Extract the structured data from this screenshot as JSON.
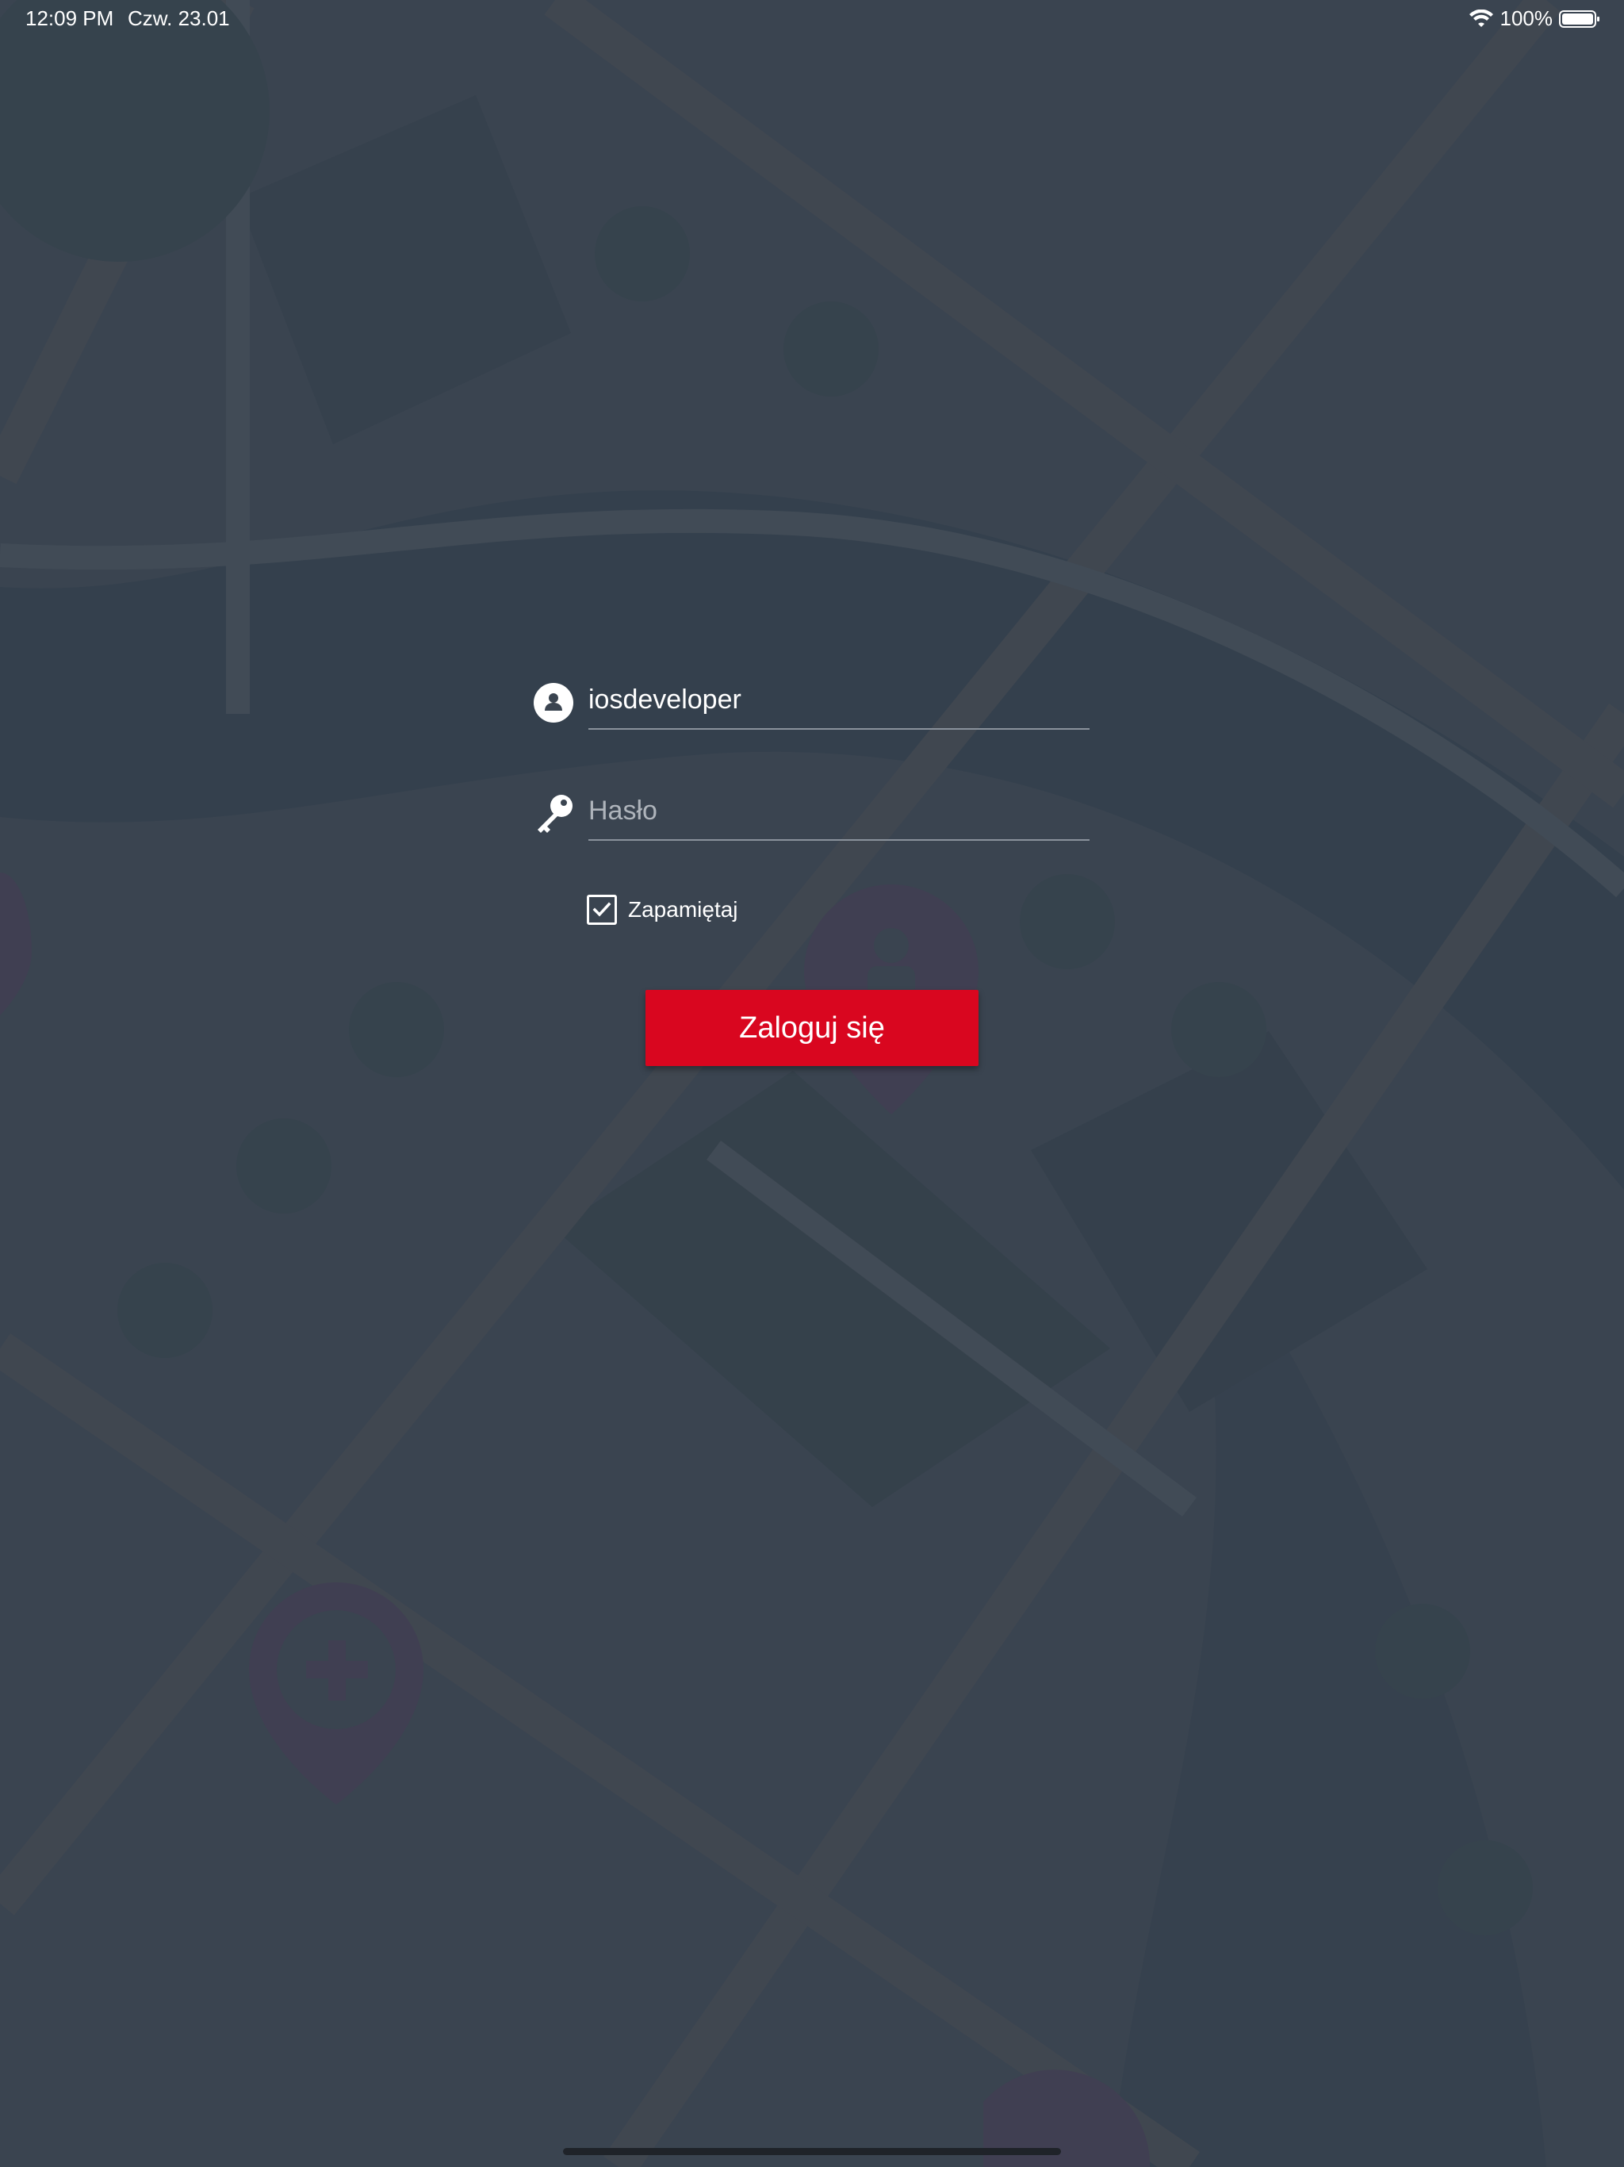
{
  "status_bar": {
    "time": "12:09 PM",
    "date": "Czw. 23.01",
    "battery": "100%",
    "wifi_icon": "wifi-icon",
    "battery_icon": "battery-full-icon"
  },
  "login": {
    "username_value": "iosdeveloper",
    "username_icon": "user-circle-icon",
    "password_placeholder": "Hasło",
    "password_icon": "key-icon",
    "remember_label": "Zapamiętaj",
    "remember_checked": true,
    "submit_label": "Zaloguj się"
  },
  "colors": {
    "background": "#3a4450",
    "accent": "#d9061f",
    "text": "#ffffff"
  }
}
